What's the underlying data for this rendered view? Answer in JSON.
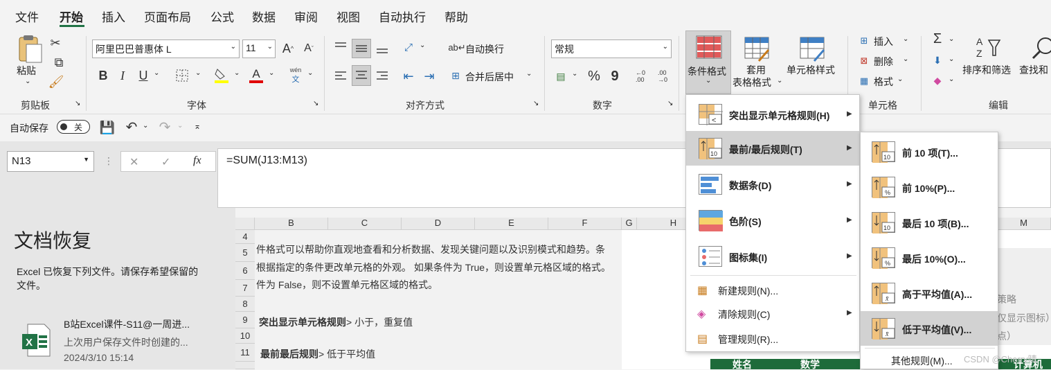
{
  "menu_tabs": [
    "文件",
    "开始",
    "插入",
    "页面布局",
    "公式",
    "数据",
    "审阅",
    "视图",
    "自动执行",
    "帮助"
  ],
  "clipboard": {
    "paste_label": "粘贴",
    "group_label": "剪贴板"
  },
  "font": {
    "name": "阿里巴巴普惠体 L",
    "size": "11",
    "group_label": "字体",
    "grow": "A",
    "shrink": "A",
    "bold": "B",
    "italic": "I",
    "underline": "U",
    "font_color_letter": "A",
    "phonetic_top": "wén",
    "phonetic_bottom": "文"
  },
  "alignment": {
    "wrap_text": "自动换行",
    "merge_center": "合并后居中",
    "group_label": "对齐方式"
  },
  "number": {
    "format": "常规",
    "group_label": "数字",
    "percent": "%",
    "comma": "9",
    "inc_decimal": "←.0\n.00",
    "dec_decimal": ".00\n→.0"
  },
  "styles": {
    "conditional_format": "条件格式",
    "format_as_table_1": "套用",
    "format_as_table_2": "表格格式",
    "cell_styles": "单元格样式"
  },
  "cells": {
    "insert": "插入",
    "delete": "删除",
    "format": "格式",
    "group_label": "单元格"
  },
  "editing": {
    "sigma": "Σ",
    "sort_filter": "排序和筛选",
    "find_select": "查找和",
    "group_label": "编辑"
  },
  "qat": {
    "autosave_label": "自动保存",
    "toggle_state": "关"
  },
  "formula_bar": {
    "name_box": "N13",
    "cancel": "✕",
    "enter": "✓",
    "fx": "fx",
    "formula": "=SUM(J13:M13)"
  },
  "recovery": {
    "title": "文档恢复",
    "description_1": "Excel 已恢复下列文件。请保存希望保留的",
    "description_2": "文件。",
    "file_name": "B站Excel课件-S11@一周进...",
    "file_desc": "上次用户保存文件时创建的...",
    "file_time": "2024/3/10 15:14"
  },
  "sheet": {
    "columns": [
      "B",
      "C",
      "D",
      "E",
      "F",
      "G",
      "H",
      "M"
    ],
    "rows": [
      "4",
      "5",
      "6",
      "7",
      "8",
      "9",
      "10",
      "11"
    ],
    "text_5": "件格式可以帮助你直观地查看和分析数据、发现关键问题以及识别模式和趋势。条",
    "text_6": "根据指定的条件更改单元格的外观。 如果条件为 True，则设置单元格区域的格式。",
    "text_7": "件为 False，则不设置单元格区域的格式。",
    "text_9_bold": "突出显示单元格规则",
    "text_9_rest": "> 小于，重复值",
    "text_11_bold": "最前最后规则",
    "text_11_rest": "> 低于平均值",
    "right_text_1": "策略",
    "right_text_2": "仅显示图标）",
    "right_text_3": "点）",
    "header_name": "姓名",
    "header_math": "数学",
    "header_cs": "计算机"
  },
  "cf_menu": {
    "items": [
      {
        "label": "突出显示单元格规则(H)",
        "icon": "highlight-rules-icon"
      },
      {
        "label": "最前/最后规则(T)",
        "icon": "top-bottom-rules-icon"
      },
      {
        "label": "数据条(D)",
        "icon": "data-bars-icon"
      },
      {
        "label": "色阶(S)",
        "icon": "color-scales-icon"
      },
      {
        "label": "图标集(I)",
        "icon": "icon-sets-icon"
      }
    ],
    "new_rule": "新建规则(N)...",
    "clear_rules": "清除规则(C)",
    "manage_rules": "管理规则(R)..."
  },
  "submenu": {
    "items": [
      {
        "label": "前 10 项(T)...",
        "badge": "10"
      },
      {
        "label": "前 10%(P)...",
        "badge": "%"
      },
      {
        "label": "最后 10 项(B)...",
        "badge": "10"
      },
      {
        "label": "最后 10%(O)...",
        "badge": "%"
      },
      {
        "label": "高于平均值(A)...",
        "badge": "x̄"
      },
      {
        "label": "低于平均值(V)...",
        "badge": "x̄"
      }
    ],
    "other_rules": "其他规则(M)..."
  },
  "watermark": "CSDN @Cherry晴",
  "colors": {
    "accent": "#217346",
    "hover": "#d2d2d2",
    "dark_green_header": "#1e6b3a"
  }
}
